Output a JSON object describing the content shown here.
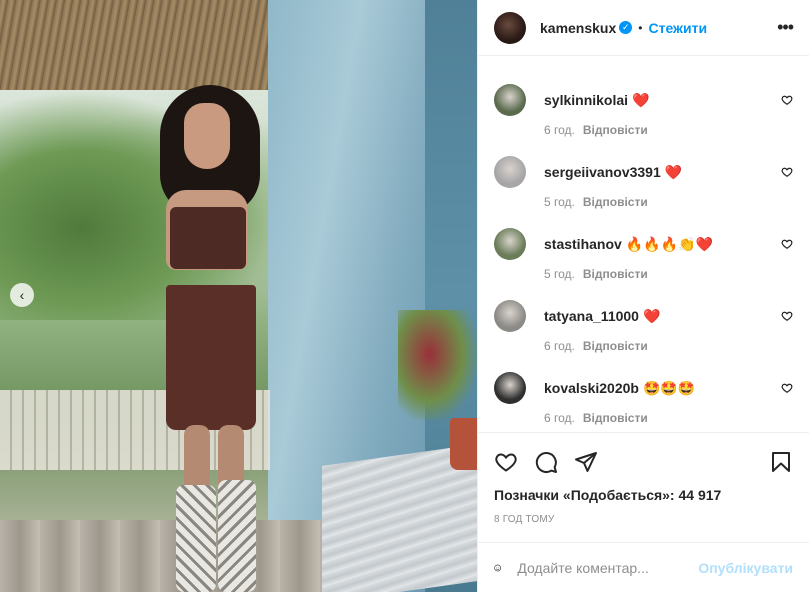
{
  "post": {
    "username": "kamenskux",
    "follow_label": "Стежити",
    "separator": "•",
    "more_label": "•••",
    "verified_mark": "✓"
  },
  "comments": [
    {
      "user": "sylkinnikolai",
      "text": "❤️",
      "time": "6 год.",
      "reply": "Відповісти",
      "avatar_color": "#5b6b4e"
    },
    {
      "user": "sergeiivanov3391",
      "text": "❤️",
      "time": "5 год.",
      "reply": "Відповісти",
      "avatar_color": "#a7a5a8"
    },
    {
      "user": "stastihanov",
      "text": "🔥🔥🔥👏❤️",
      "time": "5 год.",
      "reply": "Відповісти",
      "avatar_color": "#6a7c58"
    },
    {
      "user": "tatyana_11000",
      "text": "❤️",
      "time": "6 год.",
      "reply": "Відповісти",
      "avatar_color": "#8c8a86"
    },
    {
      "user": "kovalski2020b",
      "text": "🤩🤩🤩",
      "time": "6 год.",
      "reply": "Відповісти",
      "avatar_color": "#2f2f2f"
    }
  ],
  "likes_text": "Позначки «Подобається»: 44 917",
  "time_ago": "8 ГОД ТОМУ",
  "add_comment": {
    "placeholder": "Додайте коментар...",
    "post_label": "Опублікувати"
  },
  "icons": {
    "carousel_prev": "‹",
    "like": "heart-icon",
    "comment": "comment-icon",
    "share": "share-icon",
    "save": "bookmark-icon",
    "emoji": "emoji-icon"
  }
}
